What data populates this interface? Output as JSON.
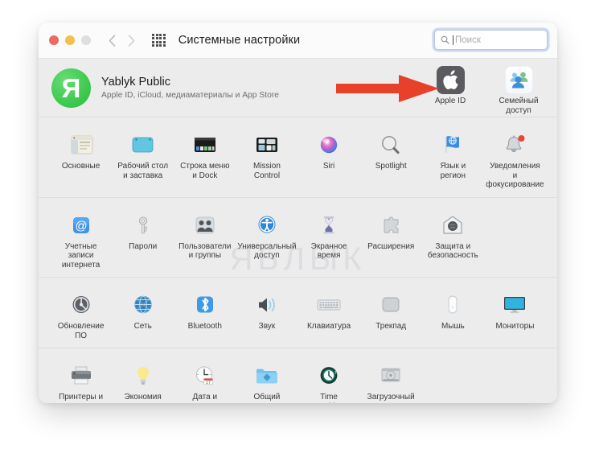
{
  "window": {
    "title": "Системные настройки",
    "traffic_lights": [
      "close",
      "minimize",
      "zoom"
    ],
    "grid_icon": "grid-dots-icon",
    "back_icon": "chevron-left-icon",
    "forward_icon": "chevron-right-icon"
  },
  "search": {
    "placeholder": "Поиск",
    "value": "",
    "icon": "search-icon"
  },
  "account": {
    "avatar_letter": "Я",
    "avatar_color": "#3ec94f",
    "name": "Yablyk Public",
    "subtitle": "Apple ID, iCloud, медиаматериалы и App Store",
    "tiles": [
      {
        "label": "Apple ID",
        "icon": "apple-logo-icon"
      },
      {
        "label": "Семейный\nдоступ",
        "icon": "family-sharing-icon"
      }
    ]
  },
  "annotation": {
    "arrow_color": "#e8412a",
    "points_to": "Apple ID"
  },
  "watermark": "ЯБЛЫК",
  "sections": [
    {
      "name": "personal",
      "items": [
        {
          "label": "Основные",
          "icon": "general-icon"
        },
        {
          "label": "Рабочий стол\nи заставка",
          "icon": "desktop-screensaver-icon"
        },
        {
          "label": "Строка меню\nи Dock",
          "icon": "menubar-dock-icon"
        },
        {
          "label": "Mission\nControl",
          "icon": "mission-control-icon"
        },
        {
          "label": "Siri",
          "icon": "siri-icon"
        },
        {
          "label": "Spotlight",
          "icon": "spotlight-icon"
        },
        {
          "label": "Язык и\nрегион",
          "icon": "language-region-icon"
        },
        {
          "label": "Уведомления\nи фокусирование",
          "icon": "notifications-icon"
        }
      ]
    },
    {
      "name": "accounts",
      "items": [
        {
          "label": "Учетные\nзаписи интернета",
          "icon": "internet-accounts-icon"
        },
        {
          "label": "Пароли",
          "icon": "passwords-key-icon"
        },
        {
          "label": "Пользователи\nи группы",
          "icon": "users-groups-icon"
        },
        {
          "label": "Универсальный\nдоступ",
          "icon": "accessibility-icon"
        },
        {
          "label": "Экранное\nвремя",
          "icon": "screen-time-hourglass-icon"
        },
        {
          "label": "Расширения",
          "icon": "extensions-puzzle-icon"
        },
        {
          "label": "Защита и\nбезопасность",
          "icon": "security-privacy-icon"
        }
      ]
    },
    {
      "name": "hardware",
      "items": [
        {
          "label": "Обновление\nПО",
          "icon": "software-update-icon"
        },
        {
          "label": "Сеть",
          "icon": "network-globe-icon"
        },
        {
          "label": "Bluetooth",
          "icon": "bluetooth-icon"
        },
        {
          "label": "Звук",
          "icon": "sound-speaker-icon"
        },
        {
          "label": "Клавиатура",
          "icon": "keyboard-icon"
        },
        {
          "label": "Трекпад",
          "icon": "trackpad-icon"
        },
        {
          "label": "Мышь",
          "icon": "mouse-icon"
        },
        {
          "label": "Мониторы",
          "icon": "displays-icon"
        }
      ]
    },
    {
      "name": "system",
      "items": [
        {
          "label": "Принтеры и\nсканеры",
          "icon": "printers-scanners-icon"
        },
        {
          "label": "Экономия\nэнергии",
          "icon": "energy-saver-bulb-icon"
        },
        {
          "label": "Дата и\nвремя",
          "icon": "date-time-clock-icon"
        },
        {
          "label": "Общий\nдоступ",
          "icon": "sharing-folder-icon"
        },
        {
          "label": "Time\nMachine",
          "icon": "time-machine-icon"
        },
        {
          "label": "Загрузочный\nдиск",
          "icon": "startup-disk-icon"
        }
      ]
    }
  ]
}
